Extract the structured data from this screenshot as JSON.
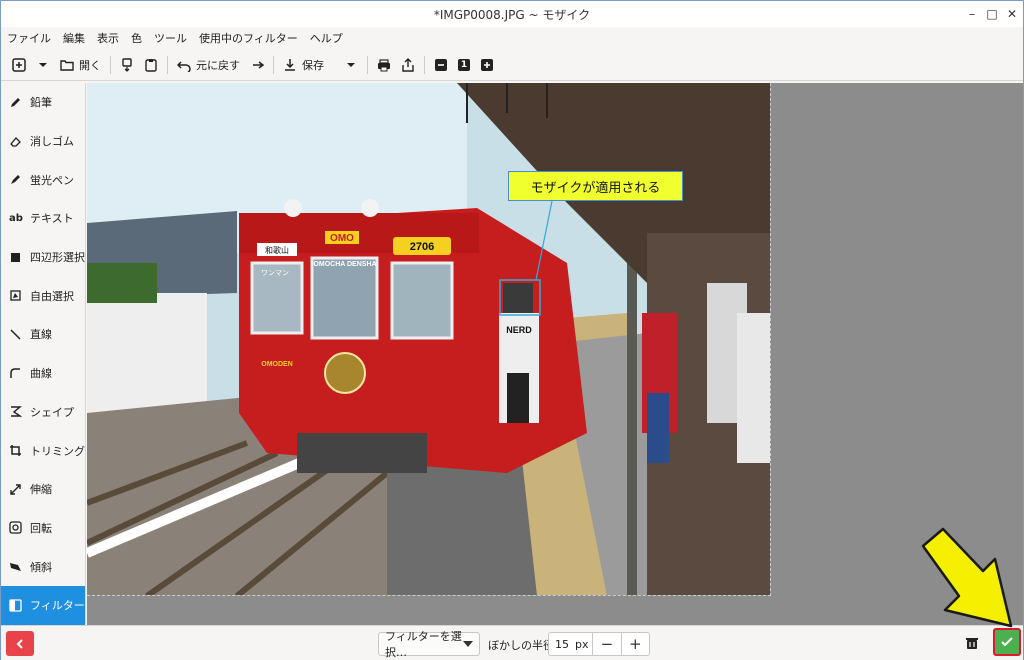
{
  "window": {
    "title": "*IMGP0008.JPG ~ モザイク"
  },
  "menubar": {
    "items": [
      "ファイル",
      "編集",
      "表示",
      "色",
      "ツール",
      "使用中のフィルター",
      "ヘルプ"
    ]
  },
  "toolbar": {
    "open_label": "開く",
    "undo_label": "元に戻す",
    "save_label": "保存",
    "zoom_value": "1"
  },
  "sidebar": {
    "tools": [
      "鉛筆",
      "消しゴム",
      "蛍光ペン",
      "テキスト",
      "四辺形選択",
      "自由選択",
      "直線",
      "曲線",
      "シェイプ",
      "トリミング",
      "伸縮",
      "回転",
      "傾斜",
      "フィルター"
    ],
    "active_tool": "フィルター"
  },
  "photo": {
    "train_sign_left": "OMO",
    "train_number": "2706",
    "train_name": "OMOCHA DENSHA",
    "destination": "和歌山",
    "oneman": "ワンマン",
    "side_text": "OMODEN",
    "shirt_text": "NERD"
  },
  "annotation": {
    "callout_text": "モザイクが適用される"
  },
  "bottombar": {
    "filter_select": "フィルターを選択…",
    "radius_label": "ぼかしの半径",
    "radius_value": "15",
    "radius_unit": "px"
  },
  "colors": {
    "accent": "#1f8fe0",
    "apply": "#4caf50",
    "cancel": "#e8434a",
    "callout": "#f0ff2e"
  }
}
